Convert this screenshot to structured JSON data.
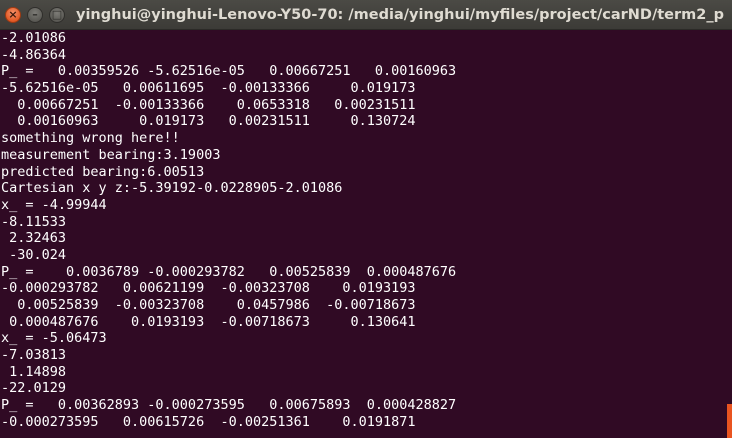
{
  "window": {
    "title": "yinghui@yinghui-Lenovo-Y50-70: /media/yinghui/myfiles/project/carND/term2_p",
    "close_glyph": "×",
    "minimize_glyph": "–",
    "maximize_glyph": "□"
  },
  "terminal": {
    "lines": [
      "-2.01086",
      "-4.86364",
      "P_ =   0.00359526 -5.62516e-05   0.00667251   0.00160963",
      "-5.62516e-05   0.00611695  -0.00133366     0.019173",
      "  0.00667251  -0.00133366    0.0653318   0.00231511",
      "  0.00160963     0.019173   0.00231511     0.130724",
      "something wrong here!!",
      "measurement bearing:3.19003",
      "predicted bearing:6.00513",
      "Cartesian x y z:-5.39192-0.0228905-2.01086",
      "x_ = -4.99944",
      "-8.11533",
      " 2.32463",
      " -30.024",
      "P_ =    0.0036789 -0.000293782   0.00525839  0.000487676",
      "-0.000293782   0.00621199  -0.00323708    0.0193193",
      "  0.00525839  -0.00323708    0.0457986  -0.00718673",
      " 0.000487676    0.0193193  -0.00718673     0.130641",
      "x_ = -5.06473",
      "-7.03813",
      " 1.14898",
      "-22.0129",
      "P_ =   0.00362893 -0.000273595   0.00675893  0.000428827",
      "-0.000273595   0.00615726  -0.00251361    0.0191871"
    ]
  }
}
